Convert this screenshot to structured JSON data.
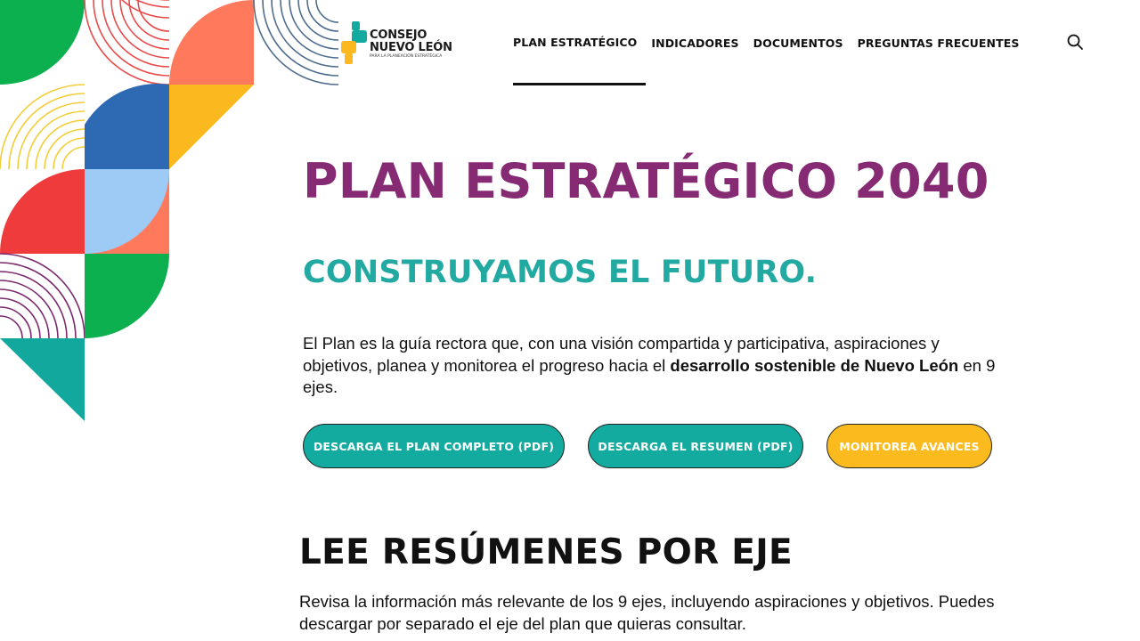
{
  "brand": {
    "line1": "CONSEJO",
    "line2": "NUEVO LEÓN",
    "tagline": "PARA LA PLANEACIÓN ESTRATÉGICA"
  },
  "nav": {
    "items": [
      {
        "label": "PLAN ESTRATÉGICO",
        "active": true
      },
      {
        "label": "INDICADORES",
        "active": false
      },
      {
        "label": "DOCUMENTOS",
        "active": false
      },
      {
        "label": "PREGUNTAS FRECUENTES",
        "active": false
      }
    ],
    "search_icon": "search-icon"
  },
  "hero": {
    "title": "PLAN ESTRATÉGICO 2040",
    "subtitle": "CONSTRUYAMOS EL FUTURO.",
    "body_before": "El Plan es la guía rectora que, con una visión compartida y participativa, aspiraciones y objetivos, planea y monitorea el progreso hacia el ",
    "body_bold": "desarrollo sostenible de Nuevo León",
    "body_after": " en 9 ejes."
  },
  "buttons": [
    {
      "label": "DESCARGA EL PLAN COMPLETO (PDF)"
    },
    {
      "label": "DESCARGA EL RESUMEN (PDF)"
    },
    {
      "label": "MONITOREA AVANCES"
    }
  ],
  "summaries": {
    "title": "LEE RESÚMENES POR EJE",
    "body": "Revisa la información más relevante de los 9 ejes, incluyendo aspiraciones y objetivos. Puedes descargar por separado el eje del plan que quieras consultar."
  },
  "colors": {
    "title_purple": "#862a73",
    "subtitle_teal": "#22a9a1",
    "button_teal": "#13aa9f",
    "button_yellow": "#fbbb1e"
  }
}
